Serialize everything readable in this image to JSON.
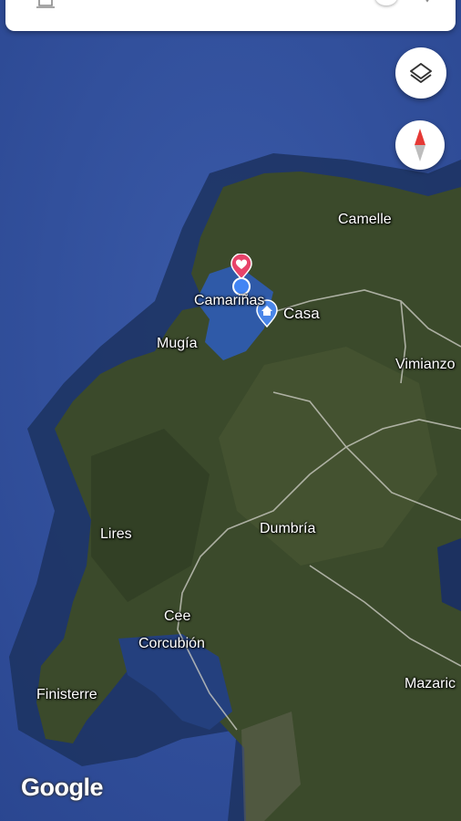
{
  "colors": {
    "ocean": "#2f4f9a",
    "land": "#3c4a2c",
    "heart_pin": "#e8436a",
    "home_pin": "#4a86e8",
    "location_dot": "#4285f4",
    "compass_north": "#e53935"
  },
  "controls": {
    "top_icons": [
      "bell-icon",
      "toggle-switch",
      "chevron-icon"
    ],
    "layers_icon": "layers-icon",
    "compass_icon": "compass-icon"
  },
  "map": {
    "places": {
      "camelle": "Camelle",
      "camarinas": "Camariñas",
      "casa": "Casa",
      "mugia": "Mugía",
      "vimianzo": "Vimianzo",
      "lires": "Lires",
      "dumbria": "Dumbría",
      "cee": "Cee",
      "corcubion": "Corcubión",
      "finisterre": "Finisterre",
      "mazaricos": "Mazaric"
    },
    "markers": [
      "heart-pin",
      "current-location-dot",
      "home-pin"
    ]
  },
  "branding": {
    "logo": "Google"
  }
}
